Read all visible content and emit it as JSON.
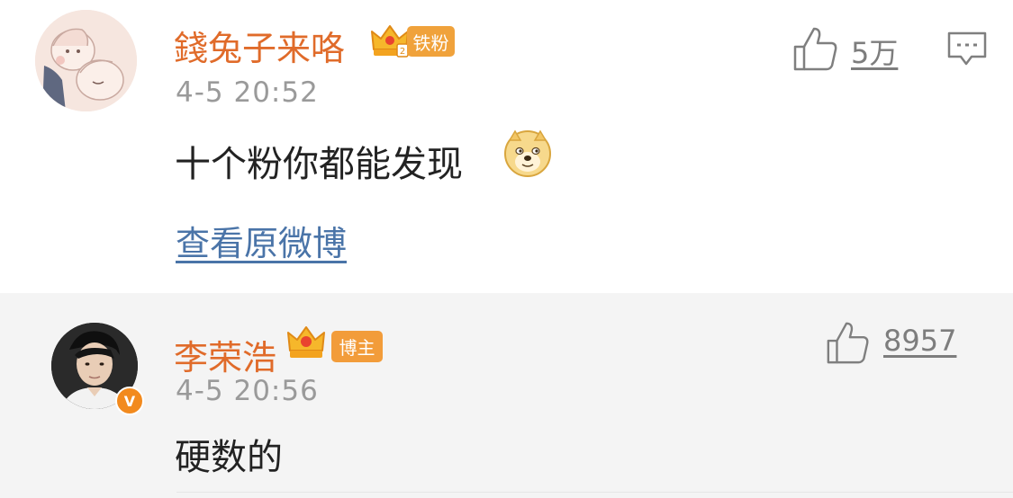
{
  "comments": [
    {
      "username": "錢兔子来咯",
      "badge": "铁粉",
      "time": "4-5 20:52",
      "text": "十个粉你都能发现",
      "emoji": "doge-emoji",
      "link": "查看原微博",
      "likes": "5万",
      "colors": {
        "name": "#e06b2a",
        "badge": "#f0a23b",
        "link": "#4a74a8"
      }
    },
    {
      "username": "李荣浩",
      "badge": "博主",
      "time": "4-5 20:56",
      "text": "硬数的",
      "likes": "8957",
      "verified": "V",
      "colors": {
        "name": "#e06b2a",
        "badge": "#f29c3a",
        "verified": "#f28a1e"
      }
    }
  ]
}
